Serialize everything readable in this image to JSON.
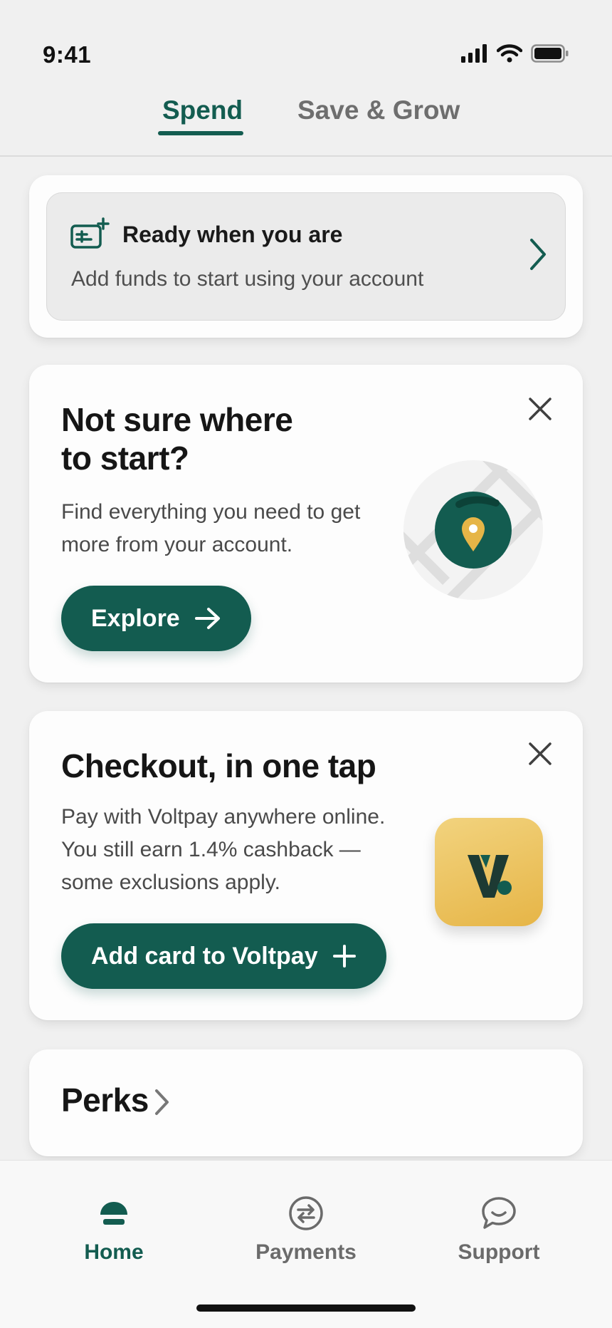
{
  "status_bar": {
    "time": "9:41"
  },
  "tabs": [
    {
      "label": "Spend",
      "active": true
    },
    {
      "label": "Save & Grow",
      "active": false
    }
  ],
  "funds_card": {
    "icon": "wallet-add-icon",
    "title": "Ready when you are",
    "subtitle": "Add funds to start using your account"
  },
  "start_card": {
    "title_line1": "Not sure where",
    "title_line2": "to start?",
    "body_line1": "Find everything you need to get",
    "body_line2": "more from your account.",
    "button_label": "Explore"
  },
  "checkout_card": {
    "title": "Checkout, in one tap",
    "body_line1": "Pay with Voltpay anywhere online.",
    "body_line2": "You still earn 1.4% cashback —",
    "body_line3": "some exclusions apply.",
    "button_label": "Add card to Voltpay"
  },
  "perks_card": {
    "title": "Perks"
  },
  "bottom_nav": [
    {
      "label": "Home",
      "icon": "home-icon",
      "active": true
    },
    {
      "label": "Payments",
      "icon": "transfer-icon",
      "active": false
    },
    {
      "label": "Support",
      "icon": "chat-icon",
      "active": false
    }
  ],
  "colors": {
    "brand": "#135c50",
    "accent_gold": "#e6b547",
    "background": "#f0f0f0",
    "card": "#fdfdfd"
  }
}
